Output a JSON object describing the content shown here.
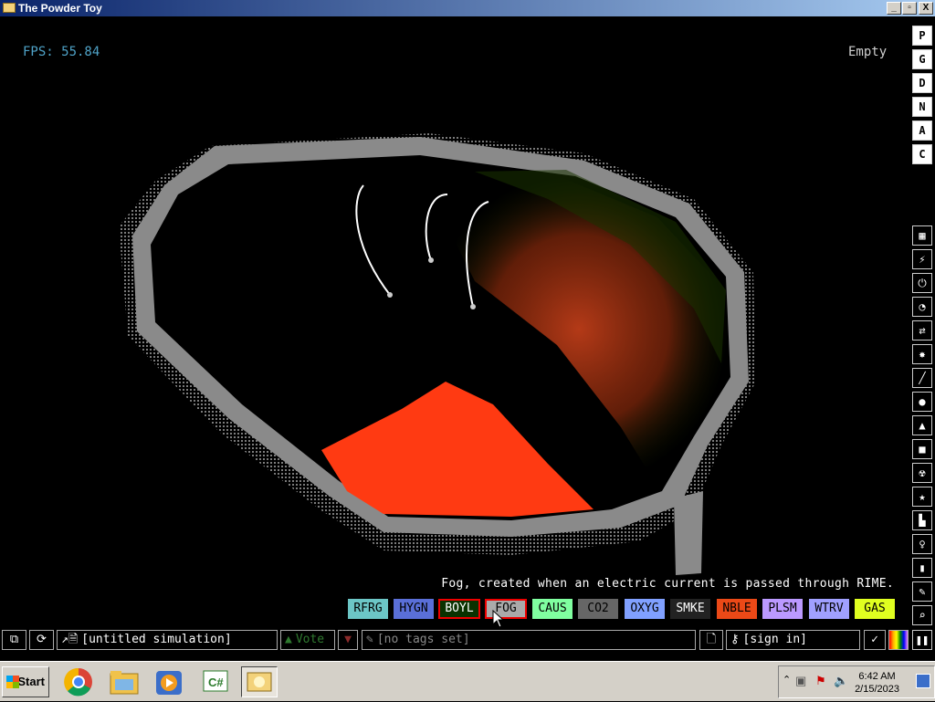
{
  "window": {
    "title": "The Powder Toy",
    "min_label": "_",
    "max_label": "▫",
    "close_label": "X"
  },
  "hud": {
    "fps": "FPS: 55.84",
    "hover_element": "Empty"
  },
  "render_modes": [
    "P",
    "G",
    "D",
    "N",
    "A",
    "C"
  ],
  "menu_icons": [
    "walls-icon",
    "electronics-icon",
    "powered-icon",
    "sensors-icon",
    "force-icon",
    "explosives-icon",
    "gases-icon",
    "liquids-icon",
    "powders-icon",
    "solids-icon",
    "radioactive-icon",
    "special-icon",
    "life-icon",
    "tools-icon",
    "favorites-icon",
    "decoration-icon",
    "search-icon",
    "pause-icon"
  ],
  "element_description": "Fog, created when an electric current is passed through RIME.",
  "elements": [
    {
      "label": "RFRG",
      "bg": "#6cc6c6",
      "fg": "#000000"
    },
    {
      "label": "HYGN",
      "bg": "#5a6fd8",
      "fg": "#000000"
    },
    {
      "label": "BOYL",
      "bg": "#0a3200",
      "fg": "#ffffff",
      "selected": true
    },
    {
      "label": "FOG",
      "bg": "#aaaaaa",
      "fg": "#000000",
      "selected": true
    },
    {
      "label": "CAUS",
      "bg": "#80ffa0",
      "fg": "#000000"
    },
    {
      "label": "CO2",
      "bg": "#666666",
      "fg": "#000000"
    },
    {
      "label": "OXYG",
      "bg": "#80a0ff",
      "fg": "#000000"
    },
    {
      "label": "SMKE",
      "bg": "#222222",
      "fg": "#ffffff"
    },
    {
      "label": "NBLE",
      "bg": "#eb4917",
      "fg": "#000000"
    },
    {
      "label": "PLSM",
      "bg": "#bb99ff",
      "fg": "#000000"
    },
    {
      "label": "WTRV",
      "bg": "#a0a0ff",
      "fg": "#000000"
    },
    {
      "label": "GAS",
      "bg": "#e0ff20",
      "fg": "#000000"
    }
  ],
  "bottom_bar": {
    "simulation_name": "[untitled simulation]",
    "vote_label": "Vote",
    "tags_label": "[no tags set]",
    "sign_in_label": "[sign in]"
  },
  "taskbar": {
    "start_label": "Start",
    "apps": [
      "chrome-icon",
      "explorer-icon",
      "media-player-icon",
      "csharp-app-icon",
      "powder-toy-icon"
    ],
    "time": "6:42 AM",
    "date": "2/15/2023"
  },
  "colors": {
    "wall": "#8a8a8a",
    "powder": "#ff3a12",
    "gas": "#b83a10",
    "fps_text": "#4fa3c8"
  }
}
